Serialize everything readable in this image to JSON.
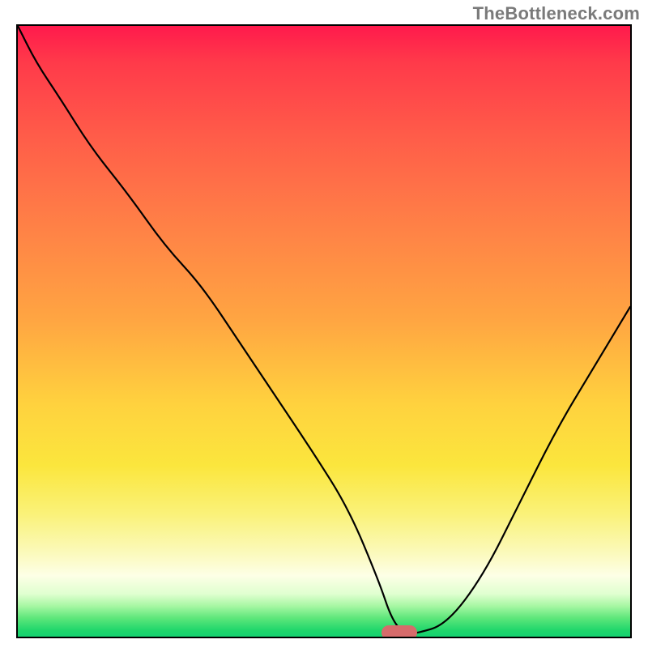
{
  "attribution": "TheBottleneck.com",
  "chart_data": {
    "type": "line",
    "title": "",
    "xlabel": "",
    "ylabel": "",
    "ylim": [
      0,
      100
    ],
    "x": [
      0.0,
      0.03,
      0.07,
      0.12,
      0.18,
      0.24,
      0.3,
      0.36,
      0.42,
      0.48,
      0.54,
      0.59,
      0.61,
      0.63,
      0.65,
      0.7,
      0.76,
      0.82,
      0.88,
      0.94,
      1.0
    ],
    "y": [
      100.0,
      94.0,
      88.0,
      80.0,
      72.5,
      64.0,
      57.5,
      48.5,
      39.5,
      30.5,
      21.0,
      9.0,
      3.0,
      0.5,
      0.5,
      2.0,
      10.0,
      22.0,
      34.0,
      44.0,
      54.0
    ],
    "marker": {
      "x": 0.62,
      "y": 0.0
    },
    "background_gradient_stops": [
      {
        "pct": 0,
        "color": "#ff1a4c"
      },
      {
        "pct": 30,
        "color": "#ff7a47"
      },
      {
        "pct": 62,
        "color": "#ffd23e"
      },
      {
        "pct": 90,
        "color": "#fdffe6"
      },
      {
        "pct": 100,
        "color": "#14d270"
      }
    ]
  }
}
